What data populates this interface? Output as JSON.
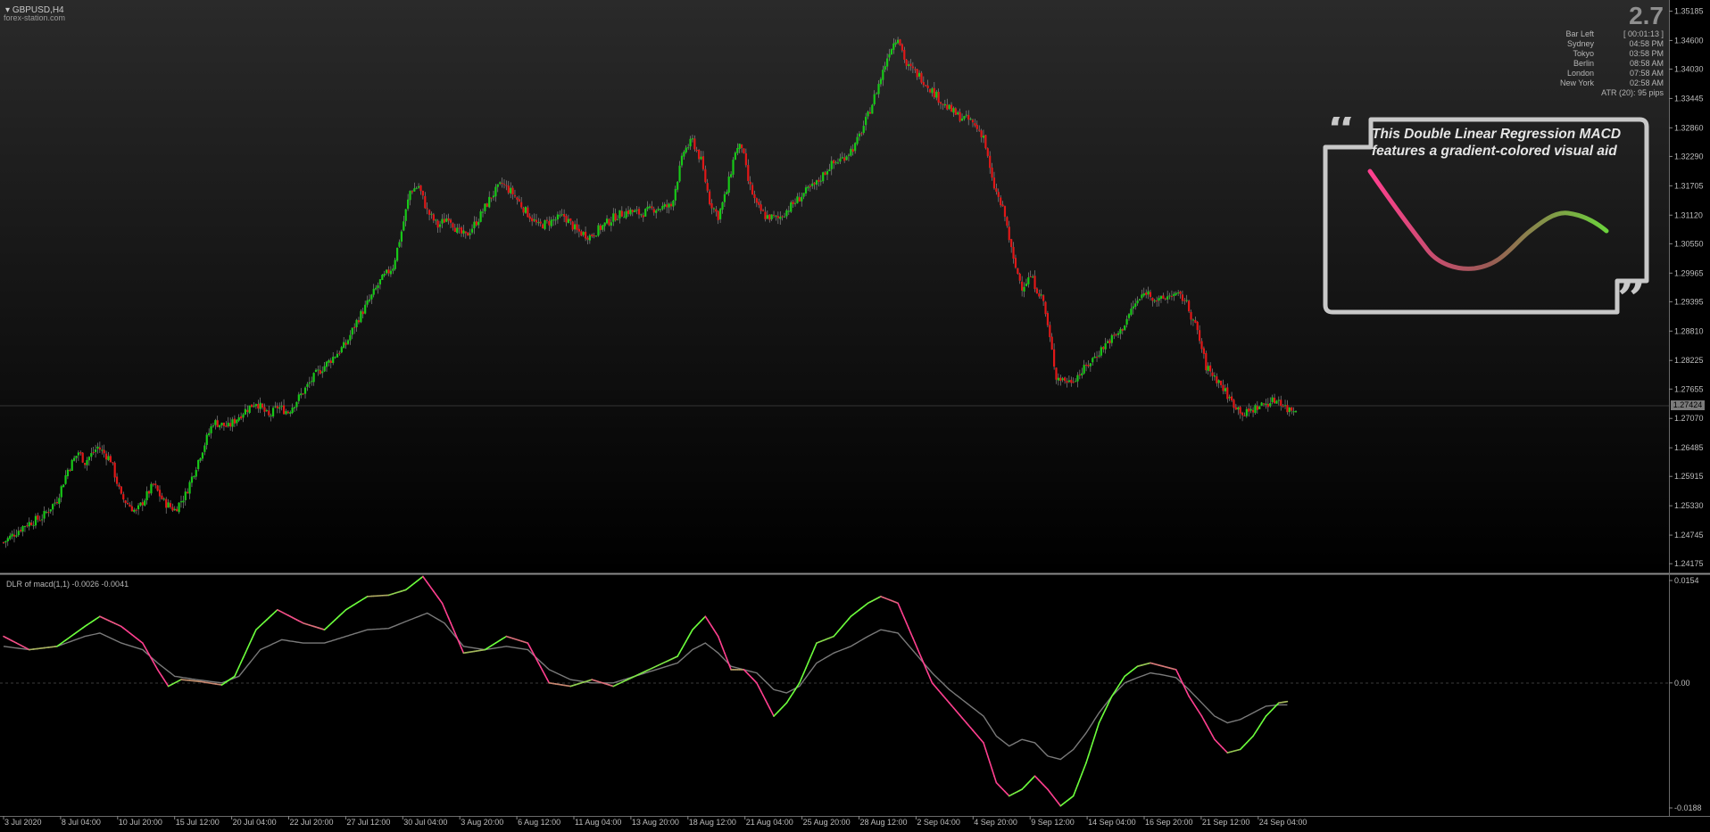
{
  "window": {
    "symbol": "GBPUSD,H4",
    "broker": "forex-station.com"
  },
  "info_panel": {
    "spread": "2.7",
    "rows": [
      {
        "k": "Bar Left",
        "v": "[ 00:01:13 ]"
      },
      {
        "k": "Sydney",
        "v": "04:58 PM"
      },
      {
        "k": "Tokyo",
        "v": "03:58 PM"
      },
      {
        "k": "Berlin",
        "v": "08:58 AM"
      },
      {
        "k": "London",
        "v": "07:58 AM"
      },
      {
        "k": "New York",
        "v": "02:58 AM"
      }
    ],
    "atr": "ATR (20): 95 pips"
  },
  "callout": {
    "text_line1": "This Double Linear Regression MACD",
    "text_line2": "features a gradient-colored visual aid"
  },
  "indicator": {
    "title": "DLR of macd(1,1) -0.0026 -0.0041"
  },
  "colors": {
    "bull": "#18c818",
    "bear": "#e01818",
    "signal": "#7a7a7a",
    "grad_low": "#ff3f8f",
    "grad_high": "#6cff3c",
    "callout_border": "#c8c8c8"
  },
  "chart_data": [
    {
      "type": "candlestick",
      "title": "GBPUSD,H4",
      "y_ticks": [
        "1.35185",
        "1.34600",
        "1.34030",
        "1.33445",
        "1.32860",
        "1.32290",
        "1.31705",
        "1.31120",
        "1.30550",
        "1.29965",
        "1.29395",
        "1.28810",
        "1.28225",
        "1.27655",
        "1.27070",
        "1.26485",
        "1.25915",
        "1.25330",
        "1.24745",
        "1.24175"
      ],
      "ylim": [
        1.24,
        1.353
      ],
      "current_price": "1.27424",
      "x_ticks": [
        "3 Jul 2020",
        "8 Jul 04:00",
        "10 Jul 20:00",
        "15 Jul 12:00",
        "20 Jul 04:00",
        "22 Jul 20:00",
        "27 Jul 12:00",
        "30 Jul 04:00",
        "3 Aug 20:00",
        "6 Aug 12:00",
        "11 Aug 04:00",
        "13 Aug 20:00",
        "18 Aug 12:00",
        "21 Aug 04:00",
        "25 Aug 20:00",
        "28 Aug 12:00",
        "2 Sep 04:00",
        "4 Sep 20:00",
        "9 Sep 12:00",
        "14 Sep 04:00",
        "16 Sep 20:00",
        "21 Sep 12:00",
        "24 Sep 04:00"
      ],
      "path": [
        [
          0,
          1.246
        ],
        [
          10,
          1.2495
        ],
        [
          18,
          1.251
        ],
        [
          25,
          1.2545
        ],
        [
          30,
          1.2605
        ],
        [
          35,
          1.264
        ],
        [
          38,
          1.262
        ],
        [
          44,
          1.265
        ],
        [
          50,
          1.2625
        ],
        [
          55,
          1.255
        ],
        [
          62,
          1.252
        ],
        [
          70,
          1.2575
        ],
        [
          75,
          1.254
        ],
        [
          80,
          1.2525
        ],
        [
          85,
          1.2555
        ],
        [
          92,
          1.2635
        ],
        [
          98,
          1.27
        ],
        [
          105,
          1.269
        ],
        [
          112,
          1.272
        ],
        [
          118,
          1.274
        ],
        [
          124,
          1.271
        ],
        [
          128,
          1.273
        ],
        [
          133,
          1.272
        ],
        [
          140,
          1.276
        ],
        [
          146,
          1.2795
        ],
        [
          152,
          1.282
        ],
        [
          160,
          1.2855
        ],
        [
          165,
          1.29
        ],
        [
          172,
          1.295
        ],
        [
          176,
          1.298
        ],
        [
          182,
          1.301
        ],
        [
          186,
          1.308
        ],
        [
          190,
          1.316
        ],
        [
          194,
          1.317
        ],
        [
          198,
          1.312
        ],
        [
          203,
          1.309
        ],
        [
          208,
          1.311
        ],
        [
          212,
          1.308
        ],
        [
          216,
          1.307
        ],
        [
          222,
          1.3105
        ],
        [
          228,
          1.315
        ],
        [
          233,
          1.3175
        ],
        [
          238,
          1.3155
        ],
        [
          244,
          1.312
        ],
        [
          250,
          1.309
        ],
        [
          256,
          1.31
        ],
        [
          262,
          1.311
        ],
        [
          268,
          1.308
        ],
        [
          274,
          1.307
        ],
        [
          280,
          1.309
        ],
        [
          286,
          1.311
        ],
        [
          292,
          1.312
        ],
        [
          298,
          1.3115
        ],
        [
          304,
          1.3125
        ],
        [
          312,
          1.313
        ],
        [
          318,
          1.324
        ],
        [
          322,
          1.326
        ],
        [
          326,
          1.322
        ],
        [
          330,
          1.314
        ],
        [
          334,
          1.311
        ],
        [
          338,
          1.316
        ],
        [
          342,
          1.324
        ],
        [
          345,
          1.325
        ],
        [
          348,
          1.318
        ],
        [
          352,
          1.313
        ],
        [
          356,
          1.311
        ],
        [
          362,
          1.3105
        ],
        [
          368,
          1.313
        ],
        [
          374,
          1.3155
        ],
        [
          380,
          1.3175
        ],
        [
          386,
          1.321
        ],
        [
          392,
          1.3225
        ],
        [
          398,
          1.325
        ],
        [
          404,
          1.331
        ],
        [
          410,
          1.3385
        ],
        [
          414,
          1.344
        ],
        [
          418,
          1.347
        ],
        [
          422,
          1.341
        ],
        [
          428,
          1.339
        ],
        [
          434,
          1.336
        ],
        [
          440,
          1.333
        ],
        [
          446,
          1.331
        ],
        [
          452,
          1.33
        ],
        [
          458,
          1.327
        ],
        [
          462,
          1.318
        ],
        [
          468,
          1.311
        ],
        [
          472,
          1.302
        ],
        [
          476,
          1.297
        ],
        [
          480,
          1.299
        ],
        [
          486,
          1.294
        ],
        [
          492,
          1.279
        ],
        [
          498,
          1.278
        ],
        [
          504,
          1.28
        ],
        [
          510,
          1.283
        ],
        [
          516,
          1.286
        ],
        [
          522,
          1.288
        ],
        [
          528,
          1.293
        ],
        [
          534,
          1.296
        ],
        [
          540,
          1.294
        ],
        [
          546,
          1.2955
        ],
        [
          552,
          1.2945
        ],
        [
          558,
          1.288
        ],
        [
          562,
          1.281
        ],
        [
          568,
          1.278
        ],
        [
          574,
          1.274
        ],
        [
          580,
          1.2715
        ],
        [
          586,
          1.273
        ],
        [
          592,
          1.274
        ],
        [
          596,
          1.2745
        ],
        [
          600,
          1.2725
        ]
      ],
      "n_candles": 605
    },
    {
      "type": "line",
      "title": "DLR of macd(1,1) -0.0026 -0.0041",
      "y_ticks": [
        "0.0154",
        "0.00",
        "-0.0188"
      ],
      "ylim": [
        -0.0188,
        0.0154
      ],
      "series": [
        {
          "name": "DLR macd",
          "points": [
            [
              0,
              0.007
            ],
            [
              12,
              0.005
            ],
            [
              25,
              0.0055
            ],
            [
              38,
              0.0085
            ],
            [
              45,
              0.01
            ],
            [
              55,
              0.0085
            ],
            [
              65,
              0.006
            ],
            [
              72,
              0.002
            ],
            [
              77,
              -0.0005
            ],
            [
              83,
              0.0005
            ],
            [
              92,
              0.0002
            ],
            [
              102,
              -0.0003
            ],
            [
              108,
              0.001
            ],
            [
              118,
              0.008
            ],
            [
              128,
              0.011
            ],
            [
              140,
              0.009
            ],
            [
              150,
              0.008
            ],
            [
              160,
              0.011
            ],
            [
              170,
              0.013
            ],
            [
              180,
              0.0132
            ],
            [
              188,
              0.014
            ],
            [
              196,
              0.016
            ],
            [
              205,
              0.012
            ],
            [
              215,
              0.0045
            ],
            [
              225,
              0.005
            ],
            [
              235,
              0.007
            ],
            [
              245,
              0.006
            ],
            [
              255,
              0.0
            ],
            [
              265,
              -0.0005
            ],
            [
              275,
              0.0005
            ],
            [
              285,
              -0.0005
            ],
            [
              295,
              0.001
            ],
            [
              305,
              0.0025
            ],
            [
              315,
              0.004
            ],
            [
              322,
              0.008
            ],
            [
              328,
              0.01
            ],
            [
              334,
              0.007
            ],
            [
              340,
              0.002
            ],
            [
              346,
              0.002
            ],
            [
              352,
              0.0
            ],
            [
              360,
              -0.005
            ],
            [
              366,
              -0.003
            ],
            [
              372,
              0.0
            ],
            [
              380,
              0.006
            ],
            [
              388,
              0.007
            ],
            [
              396,
              0.01
            ],
            [
              404,
              0.012
            ],
            [
              410,
              0.013
            ],
            [
              418,
              0.012
            ],
            [
              426,
              0.006
            ],
            [
              434,
              0.0
            ],
            [
              442,
              -0.003
            ],
            [
              450,
              -0.006
            ],
            [
              458,
              -0.009
            ],
            [
              464,
              -0.015
            ],
            [
              470,
              -0.017
            ],
            [
              476,
              -0.016
            ],
            [
              482,
              -0.014
            ],
            [
              488,
              -0.016
            ],
            [
              494,
              -0.0185
            ],
            [
              500,
              -0.017
            ],
            [
              506,
              -0.012
            ],
            [
              512,
              -0.006
            ],
            [
              518,
              -0.002
            ],
            [
              524,
              0.001
            ],
            [
              530,
              0.0025
            ],
            [
              536,
              0.003
            ],
            [
              542,
              0.0025
            ],
            [
              548,
              0.002
            ],
            [
              554,
              -0.002
            ],
            [
              560,
              -0.005
            ],
            [
              566,
              -0.0085
            ],
            [
              572,
              -0.0105
            ],
            [
              578,
              -0.01
            ],
            [
              584,
              -0.008
            ],
            [
              590,
              -0.005
            ],
            [
              596,
              -0.003
            ],
            [
              600,
              -0.0028
            ]
          ]
        },
        {
          "name": "signal",
          "points": [
            [
              0,
              0.0055
            ],
            [
              12,
              0.005
            ],
            [
              25,
              0.0055
            ],
            [
              38,
              0.007
            ],
            [
              45,
              0.0075
            ],
            [
              55,
              0.006
            ],
            [
              65,
              0.005
            ],
            [
              72,
              0.003
            ],
            [
              80,
              0.001
            ],
            [
              90,
              0.0005
            ],
            [
              102,
              0.0
            ],
            [
              110,
              0.001
            ],
            [
              120,
              0.005
            ],
            [
              130,
              0.0065
            ],
            [
              140,
              0.006
            ],
            [
              150,
              0.006
            ],
            [
              160,
              0.007
            ],
            [
              170,
              0.008
            ],
            [
              180,
              0.0082
            ],
            [
              190,
              0.0095
            ],
            [
              198,
              0.0105
            ],
            [
              206,
              0.009
            ],
            [
              215,
              0.0055
            ],
            [
              225,
              0.005
            ],
            [
              235,
              0.0055
            ],
            [
              245,
              0.005
            ],
            [
              255,
              0.002
            ],
            [
              265,
              0.0005
            ],
            [
              275,
              0.0
            ],
            [
              285,
              0.0
            ],
            [
              295,
              0.001
            ],
            [
              305,
              0.002
            ],
            [
              315,
              0.003
            ],
            [
              322,
              0.005
            ],
            [
              328,
              0.006
            ],
            [
              334,
              0.0045
            ],
            [
              340,
              0.0025
            ],
            [
              346,
              0.002
            ],
            [
              352,
              0.0015
            ],
            [
              360,
              -0.001
            ],
            [
              366,
              -0.0015
            ],
            [
              372,
              -0.0005
            ],
            [
              380,
              0.003
            ],
            [
              388,
              0.0045
            ],
            [
              396,
              0.0055
            ],
            [
              404,
              0.007
            ],
            [
              410,
              0.008
            ],
            [
              418,
              0.0075
            ],
            [
              426,
              0.0045
            ],
            [
              434,
              0.0015
            ],
            [
              442,
              -0.001
            ],
            [
              450,
              -0.003
            ],
            [
              458,
              -0.005
            ],
            [
              464,
              -0.008
            ],
            [
              470,
              -0.0095
            ],
            [
              476,
              -0.0085
            ],
            [
              482,
              -0.009
            ],
            [
              488,
              -0.011
            ],
            [
              494,
              -0.0115
            ],
            [
              500,
              -0.01
            ],
            [
              506,
              -0.0075
            ],
            [
              512,
              -0.0045
            ],
            [
              518,
              -0.002
            ],
            [
              524,
              0.0
            ],
            [
              530,
              0.0008
            ],
            [
              536,
              0.0015
            ],
            [
              542,
              0.0012
            ],
            [
              548,
              0.0008
            ],
            [
              554,
              -0.001
            ],
            [
              560,
              -0.003
            ],
            [
              566,
              -0.005
            ],
            [
              572,
              -0.006
            ],
            [
              578,
              -0.0055
            ],
            [
              584,
              -0.0045
            ],
            [
              590,
              -0.0035
            ],
            [
              596,
              -0.0033
            ],
            [
              600,
              -0.0033
            ]
          ]
        }
      ]
    }
  ]
}
